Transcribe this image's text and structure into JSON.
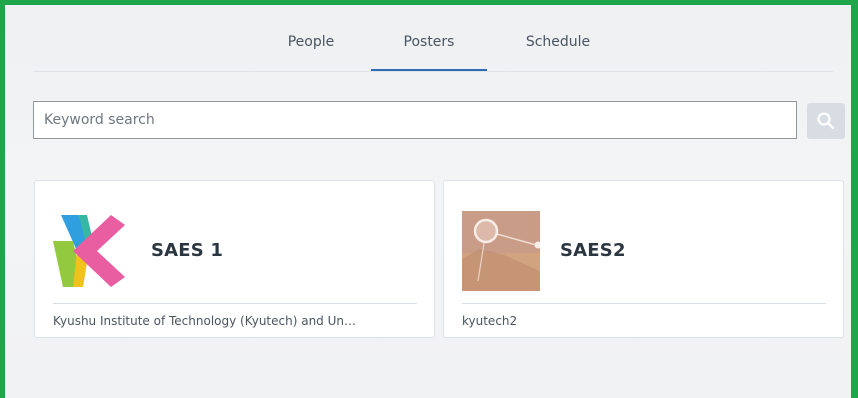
{
  "tabs": [
    {
      "label": "People"
    },
    {
      "label": "Posters",
      "active": true
    },
    {
      "label": "Schedule"
    }
  ],
  "search": {
    "placeholder": "Keyword search",
    "button_icon": "search-icon"
  },
  "cards": [
    {
      "title": "SAES 1",
      "subtitle": "Kyushu Institute of Technology (Kyutech) and Un…",
      "thumb_icon": "kyutech-logo"
    },
    {
      "title": "SAES2",
      "subtitle": "kyutech2",
      "thumb_icon": "poster-thumbnail"
    }
  ],
  "colors": {
    "frame_border": "#1fa64a",
    "active_tab": "#2f6eb3",
    "card_title": "#2c3640"
  }
}
